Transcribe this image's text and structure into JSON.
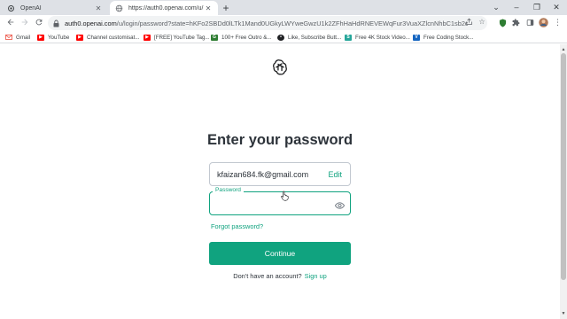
{
  "tabs": [
    {
      "title": "OpenAI",
      "active": false
    },
    {
      "title": "https://auth0.openai.com/u/login/p",
      "active": true
    }
  ],
  "window_controls": {
    "minimize": "–",
    "restore": "❐",
    "close": "✕",
    "dropdown": "⌄"
  },
  "toolbar": {
    "url_host": "auth0.openai.com",
    "url_path": "/u/login/password?state=hKFo2SBDd0lLTk1Mand0UGkyLWYweGwzU1k2ZFhHaHdRNEVEWqFur3VuaXZlcnNhbC1sb2dpbqN0a..."
  },
  "bookmarks": [
    {
      "label": "Gmail",
      "icon": "gmail-icon",
      "color": "#ea4335"
    },
    {
      "label": "YouTube",
      "icon": "youtube-icon",
      "color": "#ff0000"
    },
    {
      "label": "Channel customisat...",
      "icon": "youtube-icon",
      "color": "#ff0000"
    },
    {
      "label": "[FREE] YouTube Tag...",
      "icon": "youtube-icon",
      "color": "#ff0000"
    },
    {
      "label": "100+ Free Outro &...",
      "icon": "gif-icon",
      "color": "#2e7d32"
    },
    {
      "label": "Like, Subscribe Butt...",
      "icon": "circle-icon",
      "color": "#202124"
    },
    {
      "label": "Free 4K Stock Video...",
      "icon": "stock-icon",
      "color": "#26a69a"
    },
    {
      "label": "Free Coding Stock...",
      "icon": "v-icon",
      "color": "#1565c0"
    }
  ],
  "login": {
    "heading": "Enter your password",
    "email": "kfaizan684.fk@gmail.com",
    "edit_label": "Edit",
    "password_label": "Password",
    "password_value": "",
    "forgot_label": "Forgot password?",
    "continue_label": "Continue",
    "signup_prompt": "Don't have an account?",
    "signup_label": "Sign up"
  },
  "colors": {
    "accent": "#10a37f",
    "heading": "#2d333a",
    "border": "#c2c8d0"
  }
}
